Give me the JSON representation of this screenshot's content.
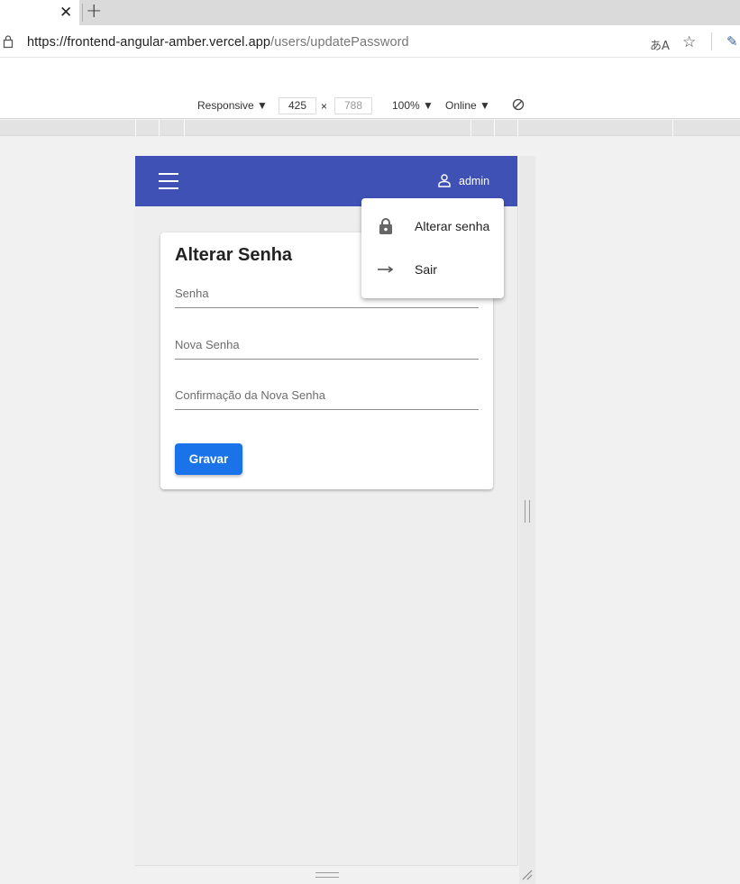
{
  "browser": {
    "url_host": "https://frontend-angular-amber.vercel.app",
    "url_path": "/users/updatePassword",
    "tab_close_glyph": "✕",
    "new_tab_glyph": "+"
  },
  "device_toolbar": {
    "mode": "Responsive ▼",
    "width": "425",
    "times": "×",
    "height": "788",
    "zoom": "100% ▼",
    "network": "Online ▼"
  },
  "appbar": {
    "user_label": "admin",
    "color": "#3f51b5"
  },
  "form": {
    "title": "Alterar Senha",
    "field_current": "Senha",
    "field_new": "Nova Senha",
    "field_confirm": "Confirmação da Nova Senha",
    "submit_label": "Gravar",
    "button_color": "#1a73e8"
  },
  "user_menu": {
    "items": [
      {
        "label": "Alterar senha",
        "icon": "lock-icon"
      },
      {
        "label": "Sair",
        "icon": "arrow-right-icon"
      }
    ]
  },
  "icons": {
    "lock": "lock-icon",
    "star": "star-icon",
    "translate": "translate-icon",
    "picker": "eyedropper-icon",
    "rotate": "rotate-icon",
    "menu": "hamburger-menu-icon",
    "user": "user-icon"
  }
}
